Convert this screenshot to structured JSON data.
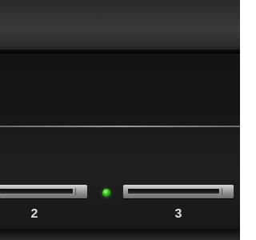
{
  "bays": [
    {
      "label": "2"
    },
    {
      "label": "3"
    }
  ],
  "status_led": {
    "color": "#3fd21e",
    "state": "on"
  }
}
